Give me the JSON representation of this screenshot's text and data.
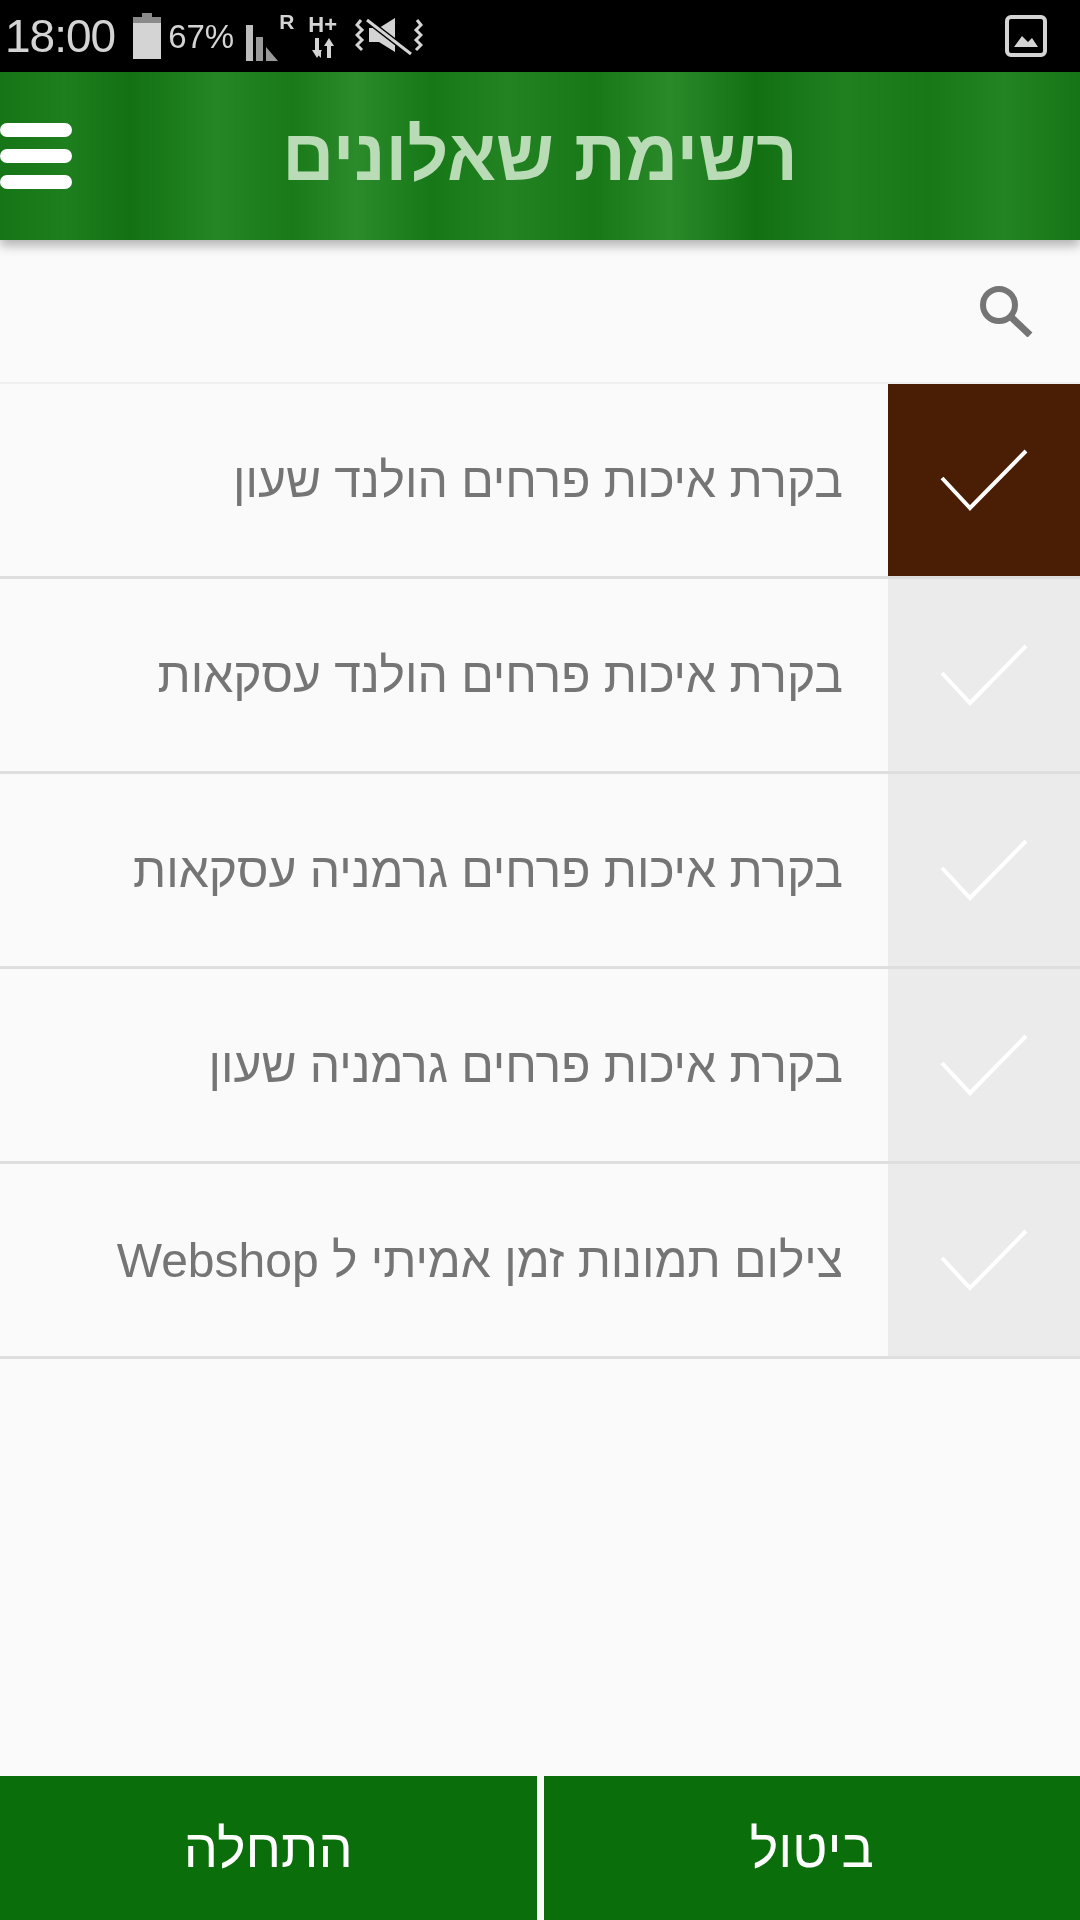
{
  "status_bar": {
    "time": "18:00",
    "battery": "67%",
    "roaming": "R",
    "network": "H+"
  },
  "header": {
    "title": "רשימת שאלונים"
  },
  "questionnaires": [
    {
      "title": "בקרת איכות פרחים הולנד שעון",
      "selected": true
    },
    {
      "title": "בקרת איכות פרחים הולנד עסקאות",
      "selected": false
    },
    {
      "title": "בקרת איכות פרחים גרמניה עסקאות",
      "selected": false
    },
    {
      "title": "בקרת איכות פרחים גרמניה שעון",
      "selected": false
    },
    {
      "title": "צילום תמונות זמן אמיתי ל Webshop",
      "selected": false
    }
  ],
  "buttons": [
    {
      "label": "ביטול"
    },
    {
      "label": "התחלה"
    }
  ]
}
